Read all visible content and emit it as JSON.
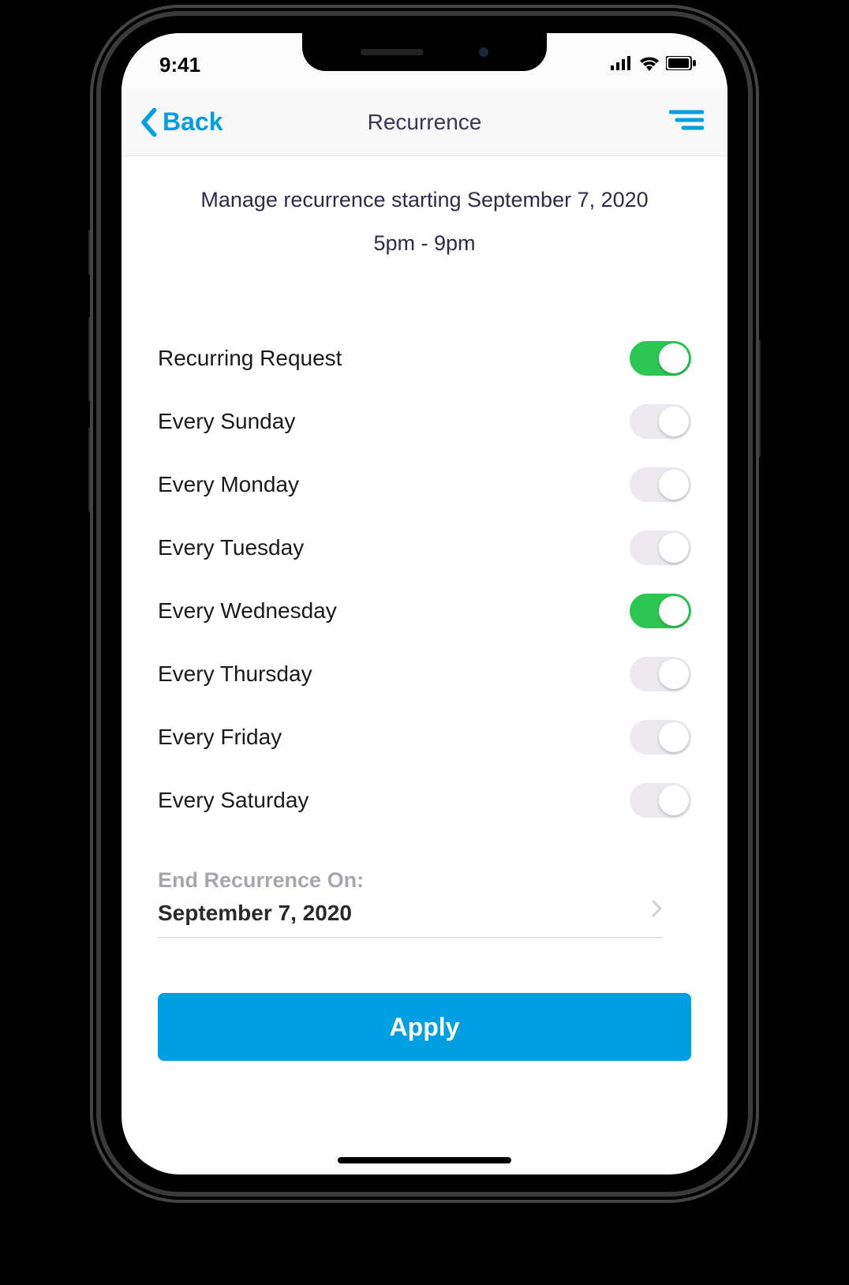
{
  "status": {
    "time": "9:41"
  },
  "nav": {
    "back_label": "Back",
    "title": "Recurrence"
  },
  "header": {
    "line": "Manage recurrence starting September 7, 2020",
    "time_range": "5pm - 9pm"
  },
  "toggles": [
    {
      "label": "Recurring Request",
      "on": true
    },
    {
      "label": "Every Sunday",
      "on": false
    },
    {
      "label": "Every Monday",
      "on": false
    },
    {
      "label": "Every Tuesday",
      "on": false
    },
    {
      "label": "Every Wednesday",
      "on": true
    },
    {
      "label": "Every Thursday",
      "on": false
    },
    {
      "label": "Every Friday",
      "on": false
    },
    {
      "label": "Every Saturday",
      "on": false
    }
  ],
  "end": {
    "label": "End Recurrence On:",
    "value": "September 7, 2020"
  },
  "apply": {
    "label": "Apply"
  },
  "colors": {
    "accent": "#009fe3",
    "toggle_on": "#2cc653"
  }
}
